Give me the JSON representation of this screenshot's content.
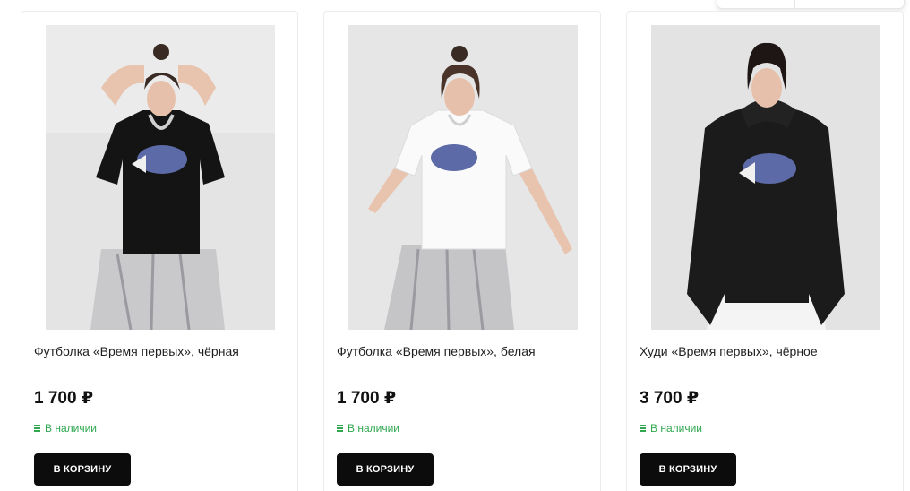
{
  "products": [
    {
      "title": "Футболка «Время первых», чёрная",
      "price": "1 700 ₽",
      "stock": "В наличии",
      "cart_label": "В корзину"
    },
    {
      "title": "Футболка «Время первых», белая",
      "price": "1 700 ₽",
      "stock": "В наличии",
      "cart_label": "В корзину"
    },
    {
      "title": "Худи «Время первых», чёрное",
      "price": "3 700 ₽",
      "stock": "В наличии",
      "cart_label": "В корзину"
    }
  ],
  "colors": {
    "accent_green": "#2fa84f",
    "button_bg": "#0c0c0c",
    "card_border": "#ececec"
  },
  "icons": {
    "stock": "stock-lines-icon"
  }
}
